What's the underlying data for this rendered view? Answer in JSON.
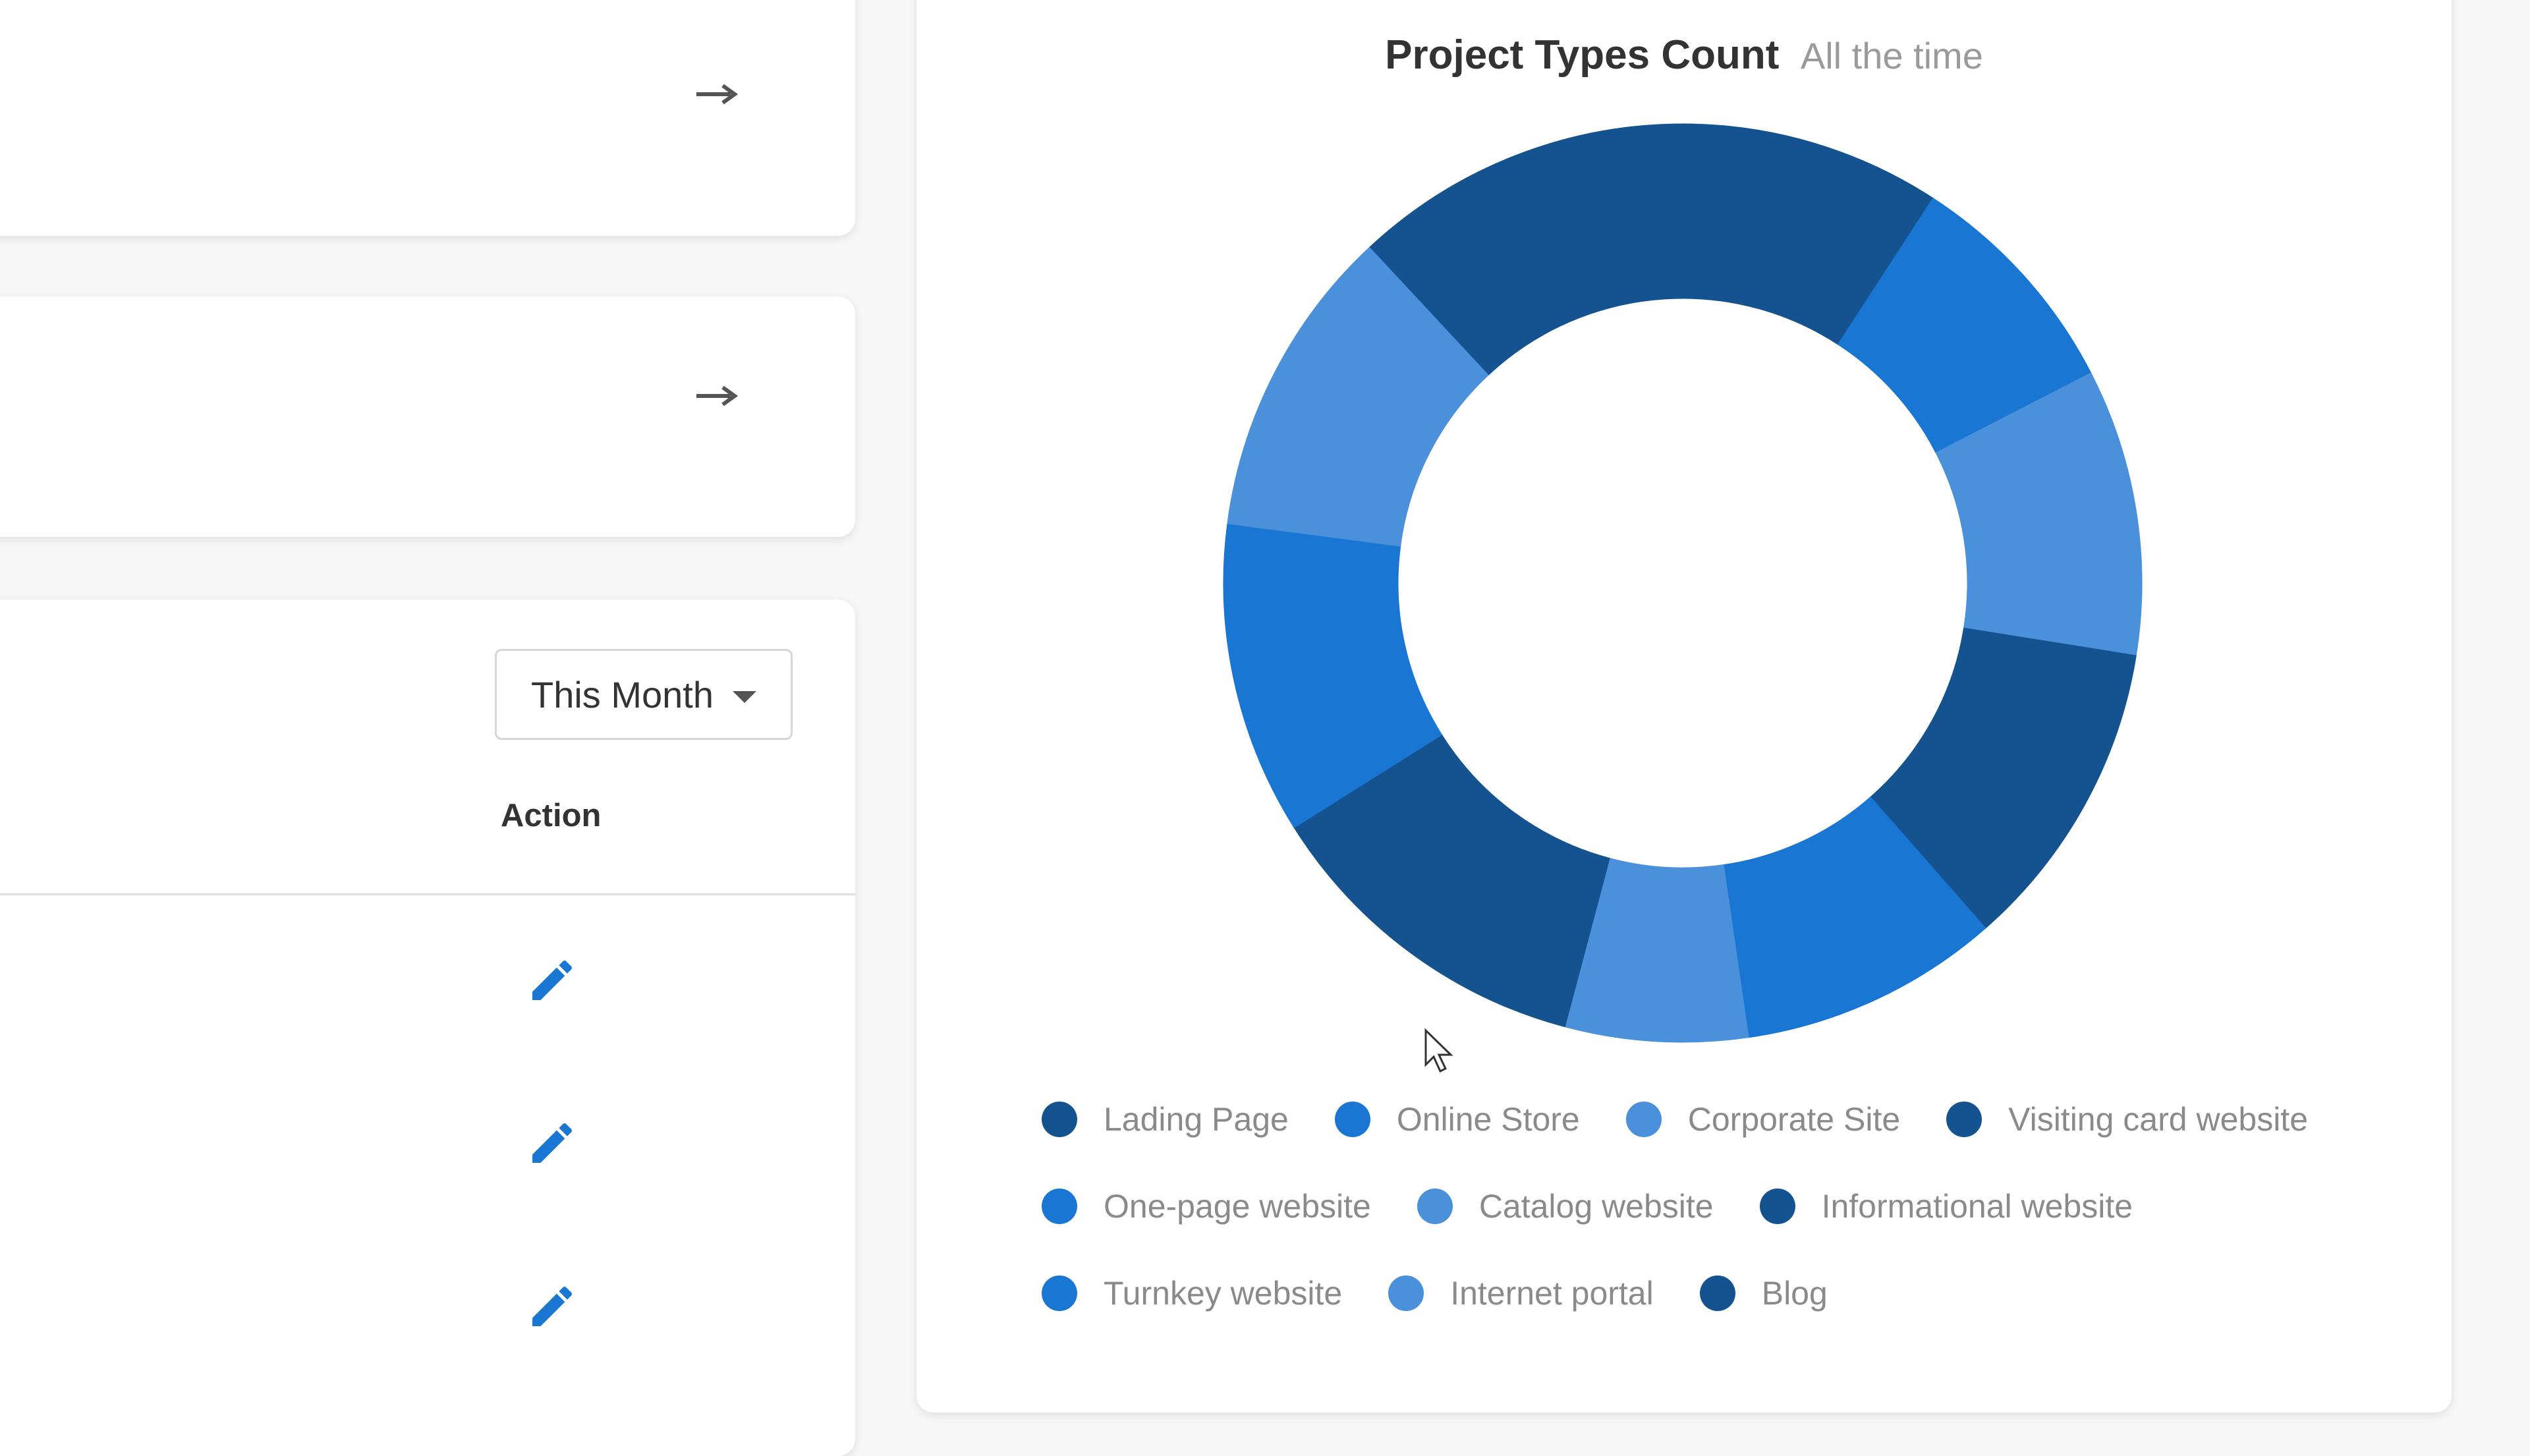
{
  "select": {
    "label": "This Month"
  },
  "table": {
    "action_header": "Action"
  },
  "colors": {
    "dark": "#14538F",
    "medium": "#1976D2",
    "light": "#4A90DB"
  },
  "chart_data": {
    "type": "pie",
    "subtype": "donut",
    "title": "Project Types Count",
    "subtitle": "All the time",
    "legend_position": "bottom",
    "categories": [
      "Lading Page",
      "Online Store",
      "Corporate Site",
      "Visiting card website",
      "One-page website",
      "Catalog website",
      "Informational website",
      "Turnkey website",
      "Internet portal",
      "Blog"
    ],
    "values": [
      10,
      9,
      11,
      12,
      10,
      7,
      13,
      12,
      12,
      13
    ],
    "colors": [
      "#14538F",
      "#1976D2",
      "#4A90DB",
      "#14538F",
      "#1976D2",
      "#4A90DB",
      "#14538F",
      "#1976D2",
      "#4A90DB",
      "#14538F"
    ]
  }
}
